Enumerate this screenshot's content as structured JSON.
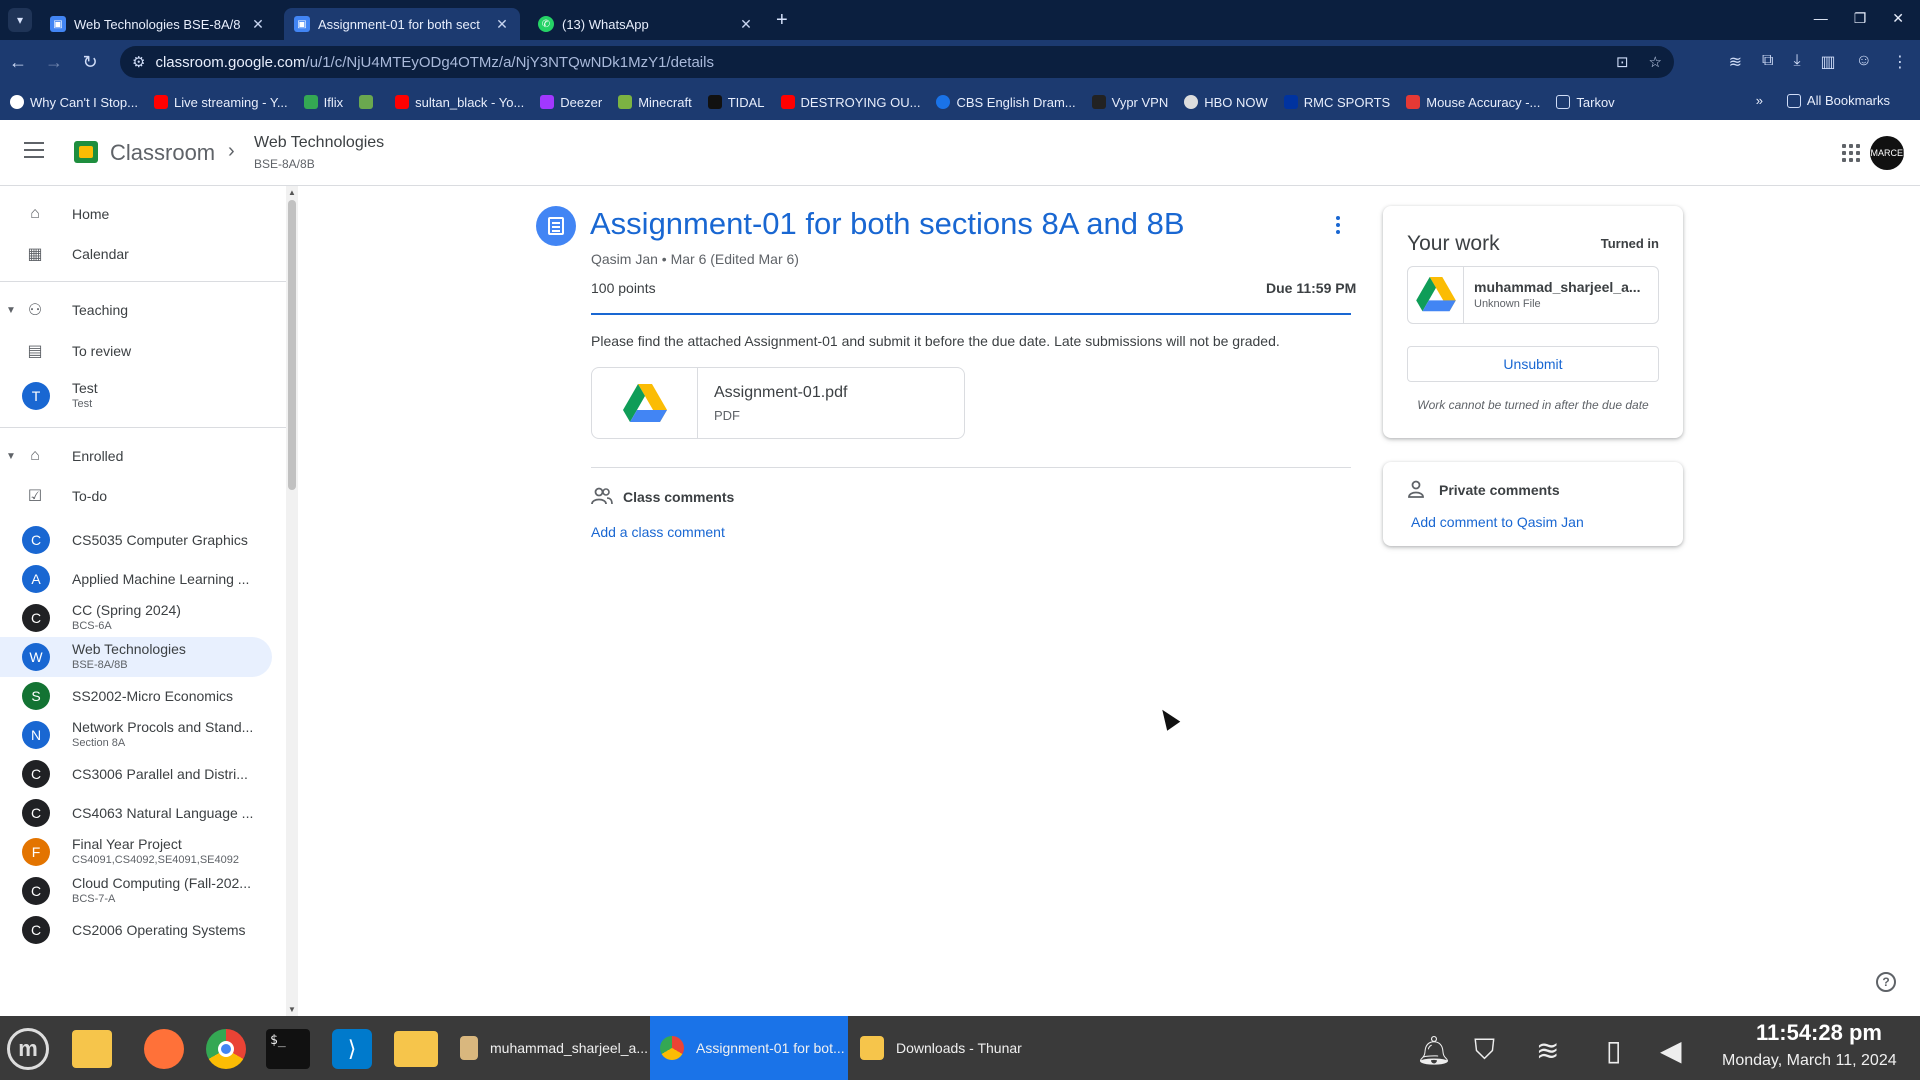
{
  "browser": {
    "tabs": [
      {
        "title": "Web Technologies BSE-8A/8",
        "active": false
      },
      {
        "title": "Assignment-01 for both sect",
        "active": true
      },
      {
        "title": "(13) WhatsApp",
        "active": false
      }
    ],
    "url_host": "classroom.google.com",
    "url_path": "/u/1/c/NjU4MTEyODg4OTMz/a/NjY3NTQwNDk1MzY1/details",
    "bookmarks": [
      "Why Can't I Stop...",
      "Live streaming - Y...",
      "Iflix",
      "",
      "sultan_black - Yo...",
      "Deezer",
      "Minecraft",
      "TIDAL",
      "DESTROYING OU...",
      "CBS English Dram...",
      "Vypr VPN",
      "HBO NOW",
      "RMC SPORTS",
      "Mouse Accuracy -...",
      "Tarkov"
    ],
    "bookmarks_overflow": "»",
    "all_bookmarks": "All Bookmarks"
  },
  "header": {
    "app_name": "Classroom",
    "course_title": "Web Technologies",
    "course_section": "BSE-8A/8B",
    "avatar_text": "SMARCEN"
  },
  "sidebar": {
    "home": "Home",
    "calendar": "Calendar",
    "teaching": "Teaching",
    "to_review": "To review",
    "test": {
      "letter": "T",
      "name": "Test",
      "sub": "Test"
    },
    "enrolled": "Enrolled",
    "todo": "To-do",
    "courses": [
      {
        "letter": "C",
        "name": "CS5035 Computer Graphics",
        "sub": "",
        "color": "#1967d2"
      },
      {
        "letter": "A",
        "name": "Applied Machine Learning ...",
        "sub": "",
        "color": "#1967d2"
      },
      {
        "letter": "C",
        "name": "CC (Spring 2024)",
        "sub": "BCS-6A",
        "color": "#202124"
      },
      {
        "letter": "W",
        "name": "Web Technologies",
        "sub": "BSE-8A/8B",
        "color": "#1967d2"
      },
      {
        "letter": "S",
        "name": "SS2002-Micro Economics",
        "sub": "",
        "color": "#137333"
      },
      {
        "letter": "N",
        "name": "Network Procols and Stand...",
        "sub": "Section 8A",
        "color": "#1967d2"
      },
      {
        "letter": "C",
        "name": "CS3006 Parallel and Distri...",
        "sub": "",
        "color": "#202124"
      },
      {
        "letter": "C",
        "name": "CS4063 Natural Language ...",
        "sub": "",
        "color": "#202124"
      },
      {
        "letter": "F",
        "name": "Final Year Project",
        "sub": "CS4091,CS4092,SE4091,SE4092",
        "color": "#e37400"
      },
      {
        "letter": "C",
        "name": "Cloud Computing (Fall-202...",
        "sub": "BCS-7-A",
        "color": "#202124"
      },
      {
        "letter": "C",
        "name": "CS2006 Operating Systems",
        "sub": "",
        "color": "#202124"
      }
    ]
  },
  "assignment": {
    "title": "Assignment-01 for both sections 8A and 8B",
    "meta": "Qasim Jan • Mar 6 (Edited Mar 6)",
    "points": "100 points",
    "due": "Due 11:59 PM",
    "description": "Please find the attached Assignment-01 and submit it before the due date. Late submissions will not be graded.",
    "attachment_name": "Assignment-01.pdf",
    "attachment_type": "PDF",
    "class_comments_label": "Class comments",
    "add_class_comment": "Add a class comment"
  },
  "your_work": {
    "title": "Your work",
    "status": "Turned in",
    "file_name": "muhammad_sharjeel_a...",
    "file_type": "Unknown File",
    "unsubmit": "Unsubmit",
    "note": "Work cannot be turned in after the due date"
  },
  "private_comments": {
    "title": "Private comments",
    "add": "Add comment to Qasim Jan"
  },
  "taskbar": {
    "windows": [
      {
        "title": "muhammad_sharjeel_a...",
        "active": false
      },
      {
        "title": "Assignment-01 for bot...",
        "active": true
      },
      {
        "title": "Downloads - Thunar",
        "active": false
      }
    ],
    "time": "11:54:28 pm",
    "date": "Monday, March 11, 2024"
  },
  "colors": {
    "accent": "#1967d2",
    "chrome_dark": "#0b1f3f",
    "chrome_mid": "#1c3a70",
    "taskbar": "#3a3a3a"
  }
}
